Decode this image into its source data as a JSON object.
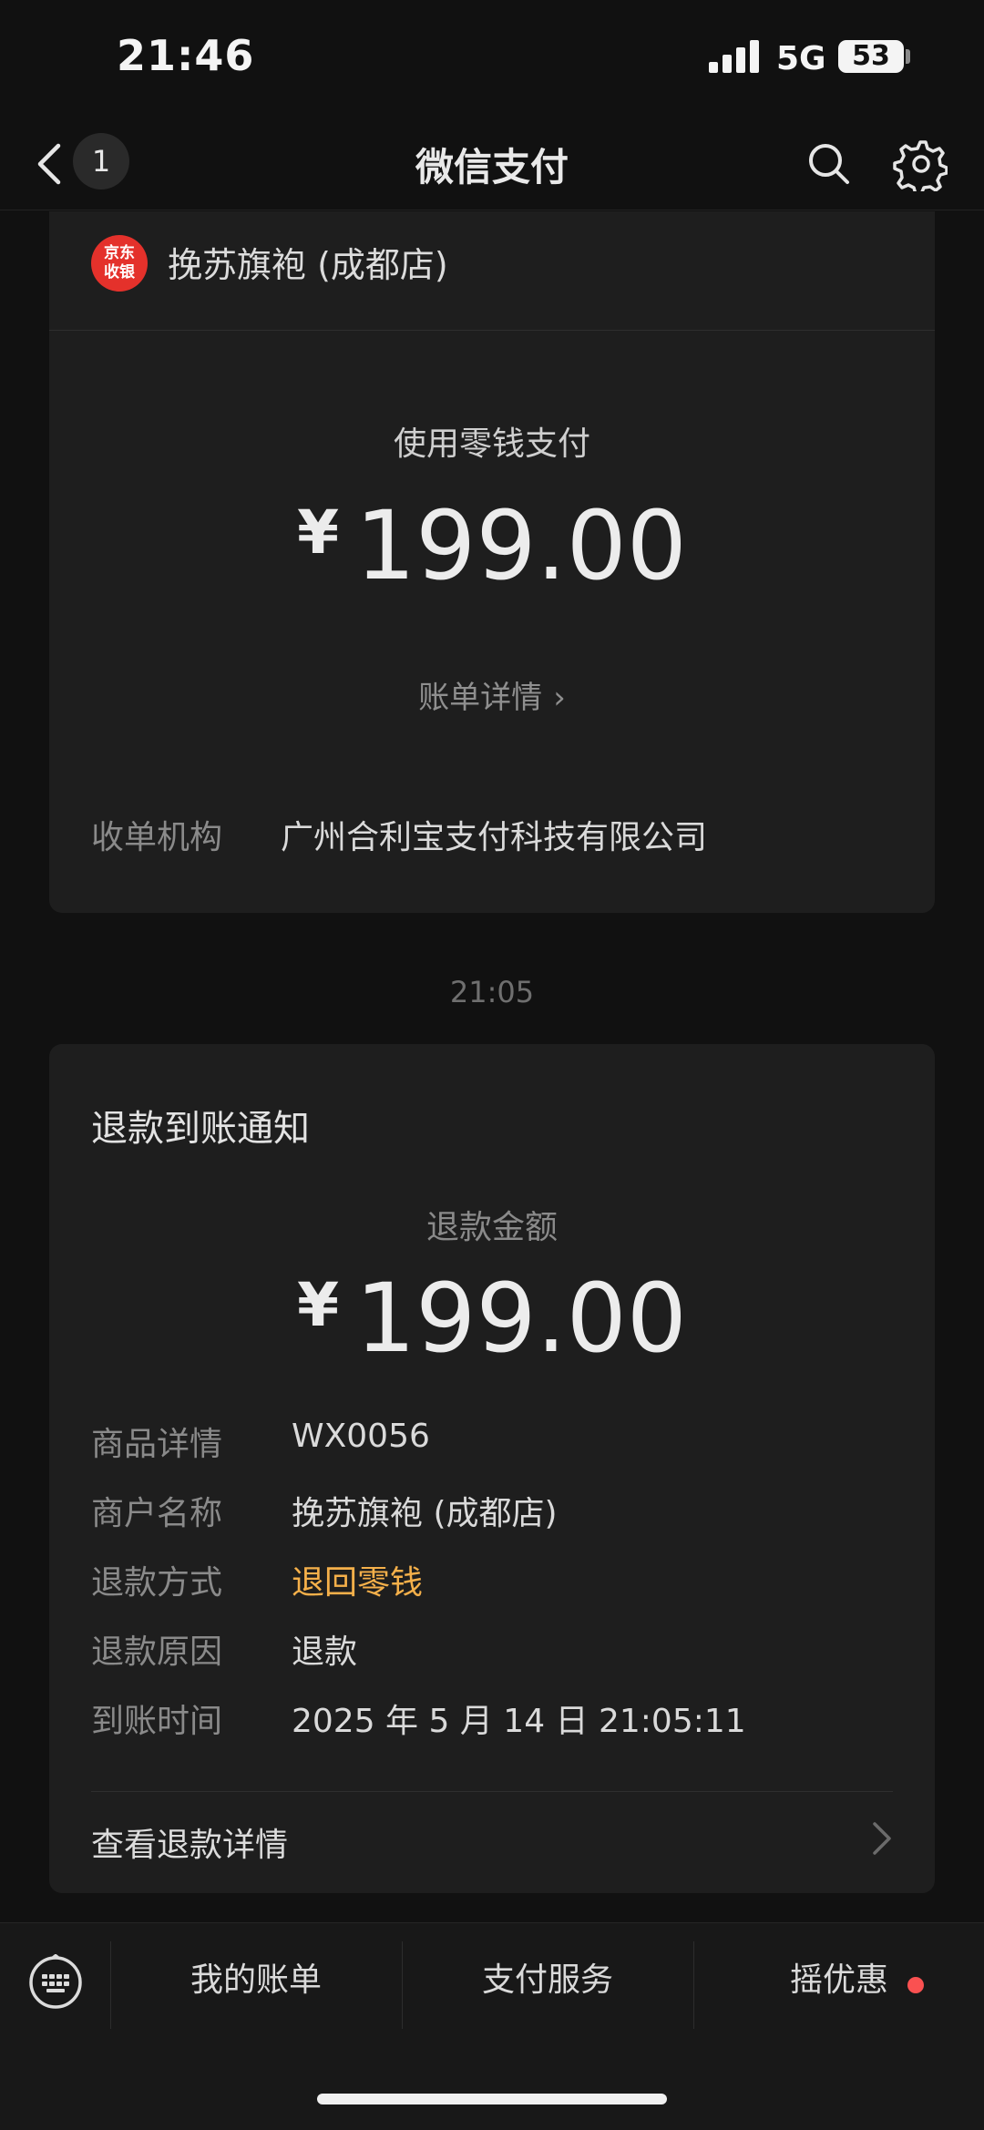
{
  "status_bar": {
    "time": "21:46",
    "network": "5G",
    "battery": "53"
  },
  "nav": {
    "badge_count": "1",
    "title": "微信支付"
  },
  "payment_card": {
    "merchant_logo_line1": "京东",
    "merchant_logo_line2": "收银",
    "merchant_name": "挽苏旗袍 (成都店)",
    "pay_method": "使用零钱支付",
    "currency": "¥",
    "amount": "199.00",
    "bill_detail_label": "账单详情",
    "acquirer_label": "收单机构",
    "acquirer_value": "广州合利宝支付科技有限公司"
  },
  "timestamp": "21:05",
  "refund_card": {
    "title": "退款到账通知",
    "amount_label": "退款金额",
    "currency": "¥",
    "amount": "199.00",
    "rows": [
      {
        "label": "商品详情",
        "value": "WX0056"
      },
      {
        "label": "商户名称",
        "value": "挽苏旗袍 (成都店)"
      },
      {
        "label": "退款方式",
        "value": "退回零钱"
      },
      {
        "label": "退款原因",
        "value": "退款"
      },
      {
        "label": "到账时间",
        "value": "2025 年 5 月 14 日 21:05:11"
      }
    ],
    "view_detail_label": "查看退款详情",
    "accent_color": "#f5b04a"
  },
  "bottom_menu": {
    "items": [
      "我的账单",
      "支付服务",
      "摇优惠"
    ],
    "dot_color": "#fa5151"
  }
}
